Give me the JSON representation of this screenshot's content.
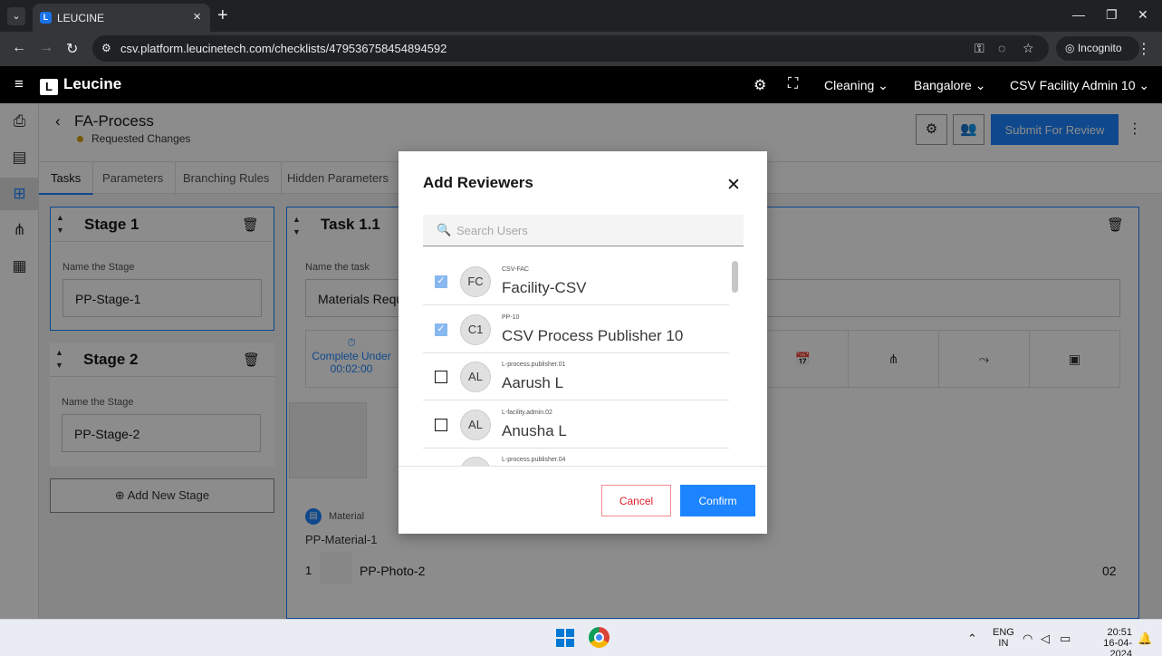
{
  "browser": {
    "tab_title": "LEUCINE",
    "url": "csv.platform.leucinetech.com/checklists/479536758454894592",
    "incognito_label": "Incognito"
  },
  "app": {
    "logo": "Leucine",
    "facility": "Cleaning",
    "location": "Bangalore",
    "user": "CSV Facility Admin 10"
  },
  "page": {
    "title": "FA-Process",
    "status": "Requested Changes",
    "submit_label": "Submit For Review",
    "tabs": [
      "Tasks",
      "Parameters",
      "Branching Rules",
      "Hidden Parameters"
    ]
  },
  "stages": [
    {
      "title": "Stage 1",
      "label": "Name the Stage",
      "value": "PP-Stage-1"
    },
    {
      "title": "Stage 2",
      "label": "Name the Stage",
      "value": "PP-Stage-2"
    }
  ],
  "add_stage_label": "Add New Stage",
  "task": {
    "title": "Task 1.1",
    "label": "Name the task",
    "value": "Materials Requ",
    "complete_under": "Complete Under",
    "duration": "00:02:00",
    "material_label": "Material",
    "material_name": "PP-Material-1",
    "material_index": "1",
    "material_photo": "PP-Photo-2",
    "material_qty": "02"
  },
  "modal": {
    "title": "Add Reviewers",
    "search_placeholder": "Search Users",
    "users": [
      {
        "initials": "FC",
        "id": "CSV-FAC",
        "name": "Facility-CSV",
        "checked": true
      },
      {
        "initials": "C1",
        "id": "PP-10",
        "name": "CSV Process Publisher 10",
        "checked": true
      },
      {
        "initials": "AL",
        "id": "L-process.publisher.01",
        "name": "Aarush L",
        "checked": false
      },
      {
        "initials": "AL",
        "id": "L-facility.admin.02",
        "name": "Anusha L",
        "checked": false
      },
      {
        "initials": "",
        "id": "L-process.publisher.04",
        "name": "",
        "checked": false
      }
    ],
    "cancel_label": "Cancel",
    "confirm_label": "Confirm"
  },
  "taskbar": {
    "lang_top": "ENG",
    "lang_bottom": "IN",
    "time": "20:51",
    "date": "16-04-2024"
  },
  "colors": {
    "accent": "#1d84ff",
    "status": "#d4a10a",
    "danger": "#da1e28"
  }
}
